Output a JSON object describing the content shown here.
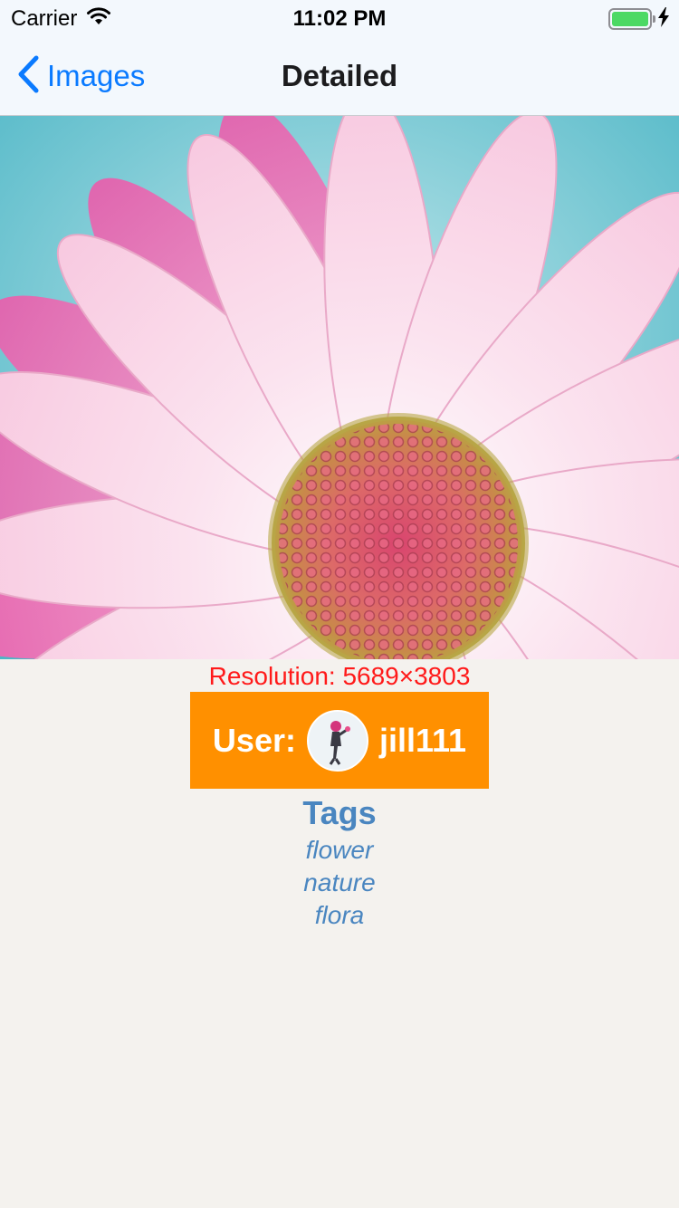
{
  "status_bar": {
    "carrier": "Carrier",
    "time": "11:02 PM",
    "battery_level": 1.0,
    "battery_color": "#4cd964"
  },
  "nav": {
    "back_label": "Images",
    "title": "Detailed",
    "tint_color": "#0a7aff"
  },
  "photo": {
    "subject": "pink-daisy-flower"
  },
  "details": {
    "resolution": "Resolution: 5689×3803",
    "resolution_color": "#ff1a1a",
    "user_label": "User:",
    "username": "jill111",
    "user_box_color": "#ff9000",
    "tags_title": "Tags",
    "tags": [
      "flower",
      "nature",
      "flora"
    ],
    "tags_color": "#4a86c0"
  }
}
